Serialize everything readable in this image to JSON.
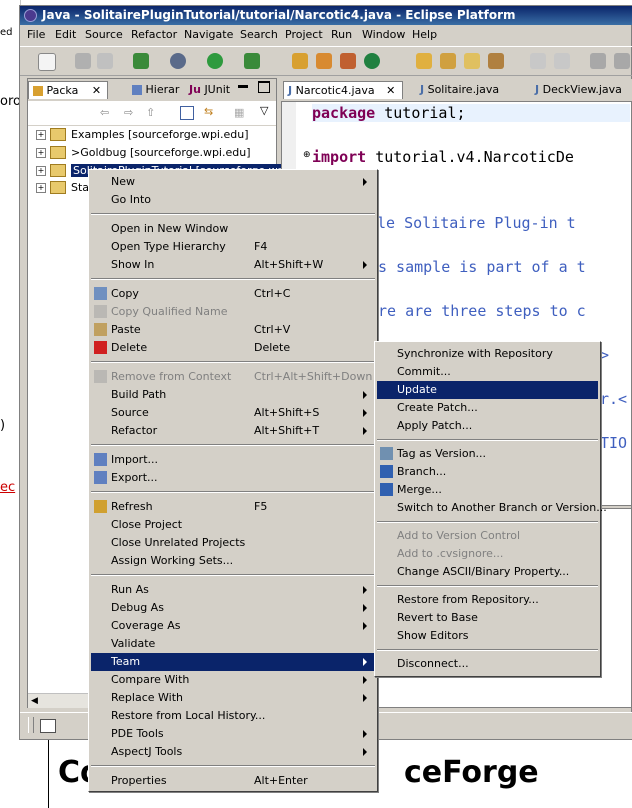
{
  "background": {
    "left_fragments": [
      "ed",
      "oro",
      ")",
      "ec"
    ],
    "bottom_heading": "Co",
    "bottom_heading_end": "ceForge"
  },
  "window": {
    "title": "Java - SolitairePluginTutorial/tutorial/Narcotic4.java - Eclipse Platform"
  },
  "menubar": {
    "items": [
      "File",
      "Edit",
      "Source",
      "Refactor",
      "Navigate",
      "Search",
      "Project",
      "Run",
      "Window",
      "Help"
    ]
  },
  "left_panel": {
    "tabs": [
      {
        "label": "Packa",
        "icon": "package-explorer-icon",
        "active": true
      },
      {
        "label": "Hierar",
        "icon": "hierarchy-icon",
        "active": false
      },
      {
        "label": "JUnit",
        "icon": "junit-icon",
        "active": false
      }
    ],
    "tree": [
      {
        "label": "Examples  [sourceforge.wpi.edu]",
        "selected": false
      },
      {
        "label": ">Goldbug  [sourceforge.wpi.edu]",
        "selected": false
      },
      {
        "label": "SolitairePluginTutorial  [sourceforge.wpi",
        "selected": true
      },
      {
        "label": "Sta",
        "selected": false
      }
    ]
  },
  "editor": {
    "tabs": [
      {
        "label": "Narcotic4.java",
        "active": true
      },
      {
        "label": "Solitaire.java",
        "active": false
      },
      {
        "label": "DeckView.java",
        "active": false
      }
    ],
    "lines": [
      {
        "kw": "package",
        "rest": " tutorial;"
      },
      {
        "kw": "import",
        "rest": " tutorial.v4.NarcoticDe"
      },
      {
        "kw": "",
        "rest": "ple Solitaire Plug-in t"
      },
      {
        "kw": "",
        "rest": "s sample is part of a t"
      },
      {
        "kw": "",
        "rest": "re are three steps to c"
      },
      {
        "kw": "",
        "rest": ">"
      },
      {
        "kw": "",
        "rest": "r.<"
      },
      {
        "kw": "",
        "rest": "TIO"
      }
    ]
  },
  "context_menu": {
    "items": [
      {
        "type": "item",
        "label": "New",
        "submenu": true
      },
      {
        "type": "item",
        "label": "Go Into"
      },
      {
        "type": "sep"
      },
      {
        "type": "item",
        "label": "Open in New Window"
      },
      {
        "type": "item",
        "label": "Open Type Hierarchy",
        "shortcut": "F4"
      },
      {
        "type": "item",
        "label": "Show In",
        "shortcut": "Alt+Shift+W",
        "submenu": true
      },
      {
        "type": "sep"
      },
      {
        "type": "item",
        "label": "Copy",
        "shortcut": "Ctrl+C",
        "icon": "copy-icon"
      },
      {
        "type": "item",
        "label": "Copy Qualified Name",
        "disabled": true,
        "icon": "copy-qualified-icon"
      },
      {
        "type": "item",
        "label": "Paste",
        "shortcut": "Ctrl+V",
        "icon": "paste-icon"
      },
      {
        "type": "item",
        "label": "Delete",
        "shortcut": "Delete",
        "icon": "delete-icon"
      },
      {
        "type": "sep"
      },
      {
        "type": "item",
        "label": "Remove from Context",
        "shortcut": "Ctrl+Alt+Shift+Down",
        "disabled": true,
        "icon": "remove-context-icon"
      },
      {
        "type": "item",
        "label": "Build Path",
        "submenu": true
      },
      {
        "type": "item",
        "label": "Source",
        "shortcut": "Alt+Shift+S",
        "submenu": true
      },
      {
        "type": "item",
        "label": "Refactor",
        "shortcut": "Alt+Shift+T",
        "submenu": true
      },
      {
        "type": "sep"
      },
      {
        "type": "item",
        "label": "Import...",
        "icon": "import-icon"
      },
      {
        "type": "item",
        "label": "Export...",
        "icon": "export-icon"
      },
      {
        "type": "sep"
      },
      {
        "type": "item",
        "label": "Refresh",
        "shortcut": "F5",
        "icon": "refresh-icon"
      },
      {
        "type": "item",
        "label": "Close Project"
      },
      {
        "type": "item",
        "label": "Close Unrelated Projects"
      },
      {
        "type": "item",
        "label": "Assign Working Sets..."
      },
      {
        "type": "sep"
      },
      {
        "type": "item",
        "label": "Run As",
        "submenu": true
      },
      {
        "type": "item",
        "label": "Debug As",
        "submenu": true
      },
      {
        "type": "item",
        "label": "Coverage As",
        "submenu": true
      },
      {
        "type": "item",
        "label": "Validate"
      },
      {
        "type": "item",
        "label": "Team",
        "submenu": true,
        "highlighted": true
      },
      {
        "type": "item",
        "label": "Compare With",
        "submenu": true
      },
      {
        "type": "item",
        "label": "Replace With",
        "submenu": true
      },
      {
        "type": "item",
        "label": "Restore from Local History..."
      },
      {
        "type": "item",
        "label": "PDE Tools",
        "submenu": true
      },
      {
        "type": "item",
        "label": "AspectJ Tools",
        "submenu": true
      },
      {
        "type": "sep"
      },
      {
        "type": "item",
        "label": "Properties",
        "shortcut": "Alt+Enter"
      }
    ]
  },
  "team_menu": {
    "items": [
      {
        "type": "item",
        "label": "Synchronize with Repository"
      },
      {
        "type": "item",
        "label": "Commit..."
      },
      {
        "type": "item",
        "label": "Update",
        "highlighted": true
      },
      {
        "type": "item",
        "label": "Create Patch..."
      },
      {
        "type": "item",
        "label": "Apply Patch..."
      },
      {
        "type": "sep"
      },
      {
        "type": "item",
        "label": "Tag as Version...",
        "icon": "tag-icon"
      },
      {
        "type": "item",
        "label": "Branch...",
        "icon": "branch-icon"
      },
      {
        "type": "item",
        "label": "Merge...",
        "icon": "merge-icon"
      },
      {
        "type": "item",
        "label": "Switch to Another Branch or Version..."
      },
      {
        "type": "sep"
      },
      {
        "type": "item",
        "label": "Add to Version Control",
        "disabled": true
      },
      {
        "type": "item",
        "label": "Add to .cvsignore...",
        "disabled": true
      },
      {
        "type": "item",
        "label": "Change ASCII/Binary Property..."
      },
      {
        "type": "sep"
      },
      {
        "type": "item",
        "label": "Restore from Repository..."
      },
      {
        "type": "item",
        "label": "Revert to Base"
      },
      {
        "type": "item",
        "label": "Show Editors"
      },
      {
        "type": "sep"
      },
      {
        "type": "item",
        "label": "Disconnect..."
      }
    ]
  },
  "colors": {
    "highlight": "#0a246a",
    "keyword": "#7f0055",
    "comment": "#3f5fbf",
    "chrome": "#d4d0c8"
  }
}
